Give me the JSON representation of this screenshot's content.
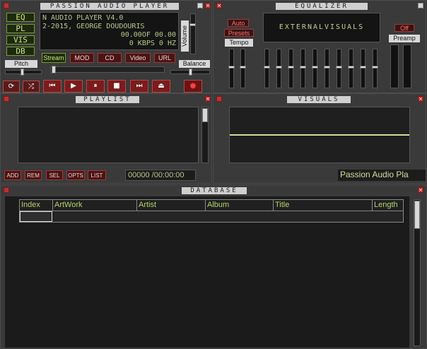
{
  "player": {
    "title": "PASSION AUDIO PLAYER",
    "lcd_line1": "N AUDIO PLAYER V4.0",
    "lcd_line2": "2-2015, GEORGE DOUDOURIS",
    "lcd_time": "00.00OF 00.00",
    "lcd_kbps": "0   KBPS 0    HZ",
    "side_buttons": [
      "EQ",
      "PL",
      "VIS",
      "DB"
    ],
    "source_buttons": [
      "Stream",
      "MOD",
      "CD",
      "Video",
      "URL"
    ],
    "pitch_label": "Pitch",
    "volume_label": "Volume",
    "balance_label": "Balance",
    "transport": {
      "repeat": "⟳",
      "shuffle": "⤮",
      "prev": "⏮",
      "play": "▶",
      "pause": "⏸",
      "stop": "■",
      "next": "⏭",
      "eject": "⏏",
      "record": "●"
    }
  },
  "equalizer": {
    "title": "EQUALIZER",
    "auto": "Auto",
    "presets": "Presets",
    "tempo": "Tempo",
    "display": "EXTERNALVISUALS",
    "off": "Off",
    "preamp": "Preamp"
  },
  "playlist": {
    "title": "PLAYLIST",
    "buttons": [
      "ADD",
      "REM",
      "SEL",
      "OPTS",
      "LIST"
    ],
    "time": "00000 /00:00:00"
  },
  "visuals": {
    "title": "VISUALS",
    "status": "Passion Audio Pla"
  },
  "database": {
    "title": "DATABASE",
    "columns": [
      "Index",
      "ArtWork",
      "Artist",
      "Album",
      "Title",
      "Length"
    ]
  }
}
